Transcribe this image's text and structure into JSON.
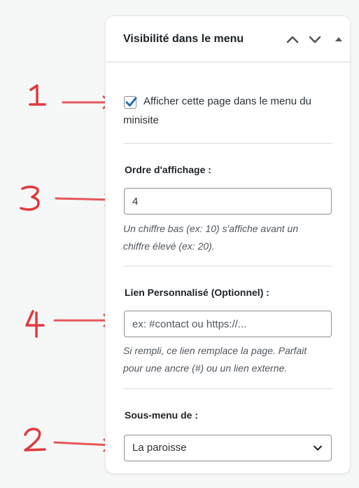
{
  "panel": {
    "title": "Visibilité dans le menu",
    "header_icons": [
      "chevron-up-icon",
      "chevron-down-icon",
      "caret-up-icon"
    ]
  },
  "show_in_menu": {
    "checked": true,
    "label_line1": "Afficher cette page dans le menu du",
    "label_line2": "minisite"
  },
  "display_order": {
    "label": "Ordre d'affichage :",
    "value": "4",
    "help_line1": "Un chiffre bas (ex: 10) s'affiche avant un",
    "help_line2": "chiffre élevé (ex: 20)."
  },
  "custom_link": {
    "label": "Lien Personnalisé (Optionnel) :",
    "value": "",
    "placeholder": "ex: #contact ou https://...",
    "help_line1": "Si rempli, ce lien remplace la page. Parfait",
    "help_line2": "pour une ancre (#) ou un lien externe."
  },
  "submenu_of": {
    "label": "Sous-menu de :",
    "selected": "La paroisse"
  },
  "annotations": {
    "color": "#e0383e",
    "arrow_color": "#e5575a",
    "numbers": [
      "1",
      "3",
      "4",
      "2"
    ]
  },
  "colors": {
    "accent": "#2271b1",
    "background": "#f6f7f7"
  }
}
